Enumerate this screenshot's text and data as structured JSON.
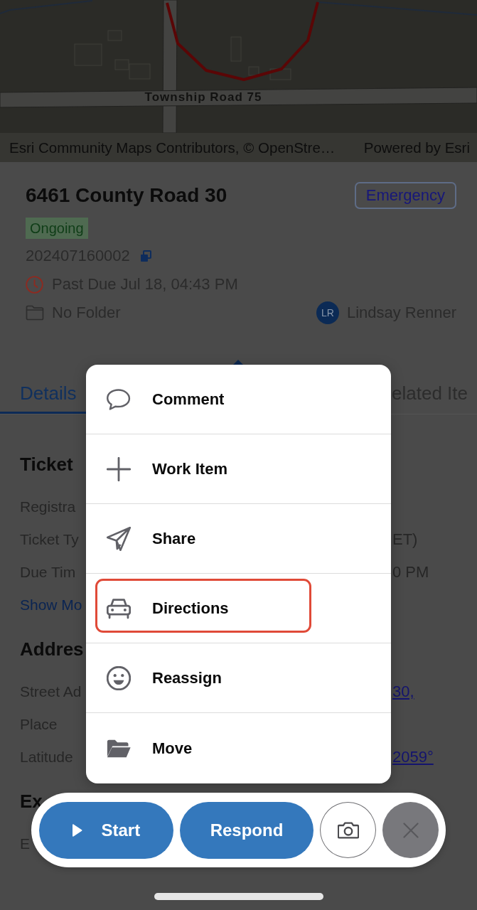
{
  "map": {
    "road_label": "Township Road 75",
    "attribution": "Esri Community Maps Contributors, © OpenStre…",
    "powered_by": "Powered by Esri"
  },
  "ticket": {
    "title": "6461 County Road 30",
    "priority": "Emergency",
    "status": "Ongoing",
    "number": "202407160002",
    "due": "Past Due Jul 18, 04:43 PM",
    "overdue": true,
    "folder": "No Folder",
    "assignee": {
      "initials": "LR",
      "name": "Lindsay Renner"
    }
  },
  "tabs": [
    {
      "label": "Details",
      "selected": true
    },
    {
      "label": "elated Ite",
      "selected": false
    }
  ],
  "sections": [
    {
      "heading": "Ticket",
      "rows": [
        {
          "label": "Registra"
        },
        {
          "label": "Ticket Ty",
          "value": "ET)",
          "link": false
        },
        {
          "label": "Due Tim",
          "value": "0 PM",
          "link": false
        }
      ],
      "link": "Show Mo"
    },
    {
      "heading": "Addres",
      "rows": [
        {
          "label": "Street Ad",
          "value": "30,",
          "link": true
        },
        {
          "label": "Place"
        },
        {
          "label": "Latitude",
          "value": "2059°",
          "link": true
        }
      ]
    },
    {
      "heading": "Ex",
      "rows": [
        {
          "label": "E"
        }
      ]
    }
  ],
  "menu": {
    "items": [
      {
        "kind": "comment",
        "label": "Comment",
        "highlighted": false
      },
      {
        "kind": "add",
        "label": "Work Item",
        "highlighted": false
      },
      {
        "kind": "share",
        "label": "Share",
        "highlighted": false
      },
      {
        "kind": "directions",
        "label": "Directions",
        "highlighted": true
      },
      {
        "kind": "reassign",
        "label": "Reassign",
        "highlighted": false
      },
      {
        "kind": "move",
        "label": "Move",
        "highlighted": false
      }
    ]
  },
  "action_bar": {
    "buttons": [
      {
        "kind": "start",
        "label": "Start"
      },
      {
        "kind": "respond",
        "label": "Respond"
      },
      {
        "kind": "camera"
      },
      {
        "kind": "close"
      }
    ]
  }
}
